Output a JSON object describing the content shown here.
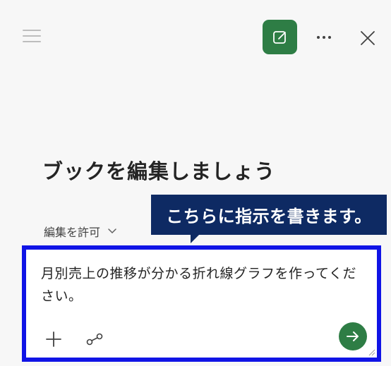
{
  "header": {
    "menu_icon": "hamburger-icon",
    "edit_icon": "compose-edit-icon",
    "more_icon": "more-dots-icon",
    "close_icon": "close-icon"
  },
  "main": {
    "title": "ブックを編集しましょう",
    "permission_label": "編集を許可",
    "permission_icon": "chevron-down-icon"
  },
  "callout": {
    "text": "こちらに指示を書きます。"
  },
  "compose": {
    "value": "月別売上の推移が分かる折れ線グラフを作ってください。",
    "add_icon": "plus-icon",
    "reference_icon": "link-reference-icon",
    "send_icon": "send-arrow-icon"
  },
  "colors": {
    "accent_green": "#2e7d45",
    "callout_bg": "#0e2a63",
    "highlight_border": "#1014e6",
    "pane_bg": "#f7f7f7"
  }
}
